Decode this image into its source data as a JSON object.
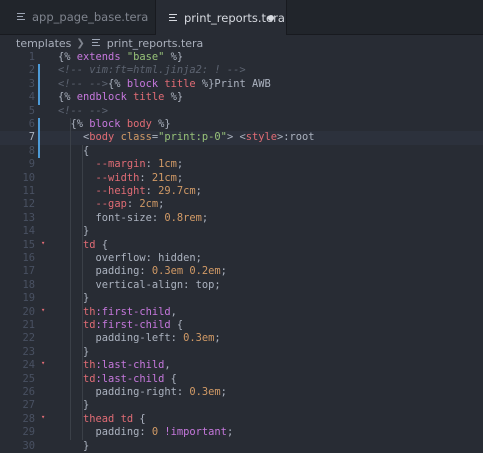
{
  "tabs": [
    {
      "label": "app_page_base.tera",
      "active": false,
      "dirty": false
    },
    {
      "label": "print_reports.tera",
      "active": true,
      "dirty": true
    }
  ],
  "breadcrumb": {
    "folder": "templates",
    "file": "print_reports.tera"
  },
  "editor": {
    "current_line": 7,
    "lines": [
      {
        "n": "1",
        "tokens": [
          [
            "p",
            "{% "
          ],
          [
            "k",
            "extends"
          ],
          [
            "p",
            " "
          ],
          [
            "s",
            "\"base\""
          ],
          [
            "p",
            " %}"
          ]
        ]
      },
      {
        "n": "2",
        "tokens": [
          [
            "c",
            "<!-- vim:ft=html.jinja2: ! -->"
          ]
        ]
      },
      {
        "n": "3",
        "tokens": [
          [
            "c",
            "<!-- -->"
          ],
          [
            "p",
            "{% "
          ],
          [
            "k",
            "block"
          ],
          [
            "p",
            " "
          ],
          [
            "t",
            "title"
          ],
          [
            "p",
            " %}Print AWB"
          ]
        ]
      },
      {
        "n": "4",
        "tokens": [
          [
            "p",
            "{% "
          ],
          [
            "k",
            "endblock"
          ],
          [
            "p",
            " "
          ],
          [
            "t",
            "title"
          ],
          [
            "p",
            " %}"
          ]
        ]
      },
      {
        "n": "5",
        "tokens": [
          [
            "c",
            "<!-- -->"
          ]
        ]
      },
      {
        "n": "6",
        "tokens": [
          [
            "p",
            "  {% "
          ],
          [
            "k",
            "block"
          ],
          [
            "p",
            " "
          ],
          [
            "t",
            "body"
          ],
          [
            "p",
            " %}"
          ]
        ]
      },
      {
        "n": "7",
        "tokens": [
          [
            "p",
            "    <"
          ],
          [
            "t",
            "body"
          ],
          [
            "p",
            " "
          ],
          [
            "a",
            "class"
          ],
          [
            "p",
            "="
          ],
          [
            "s",
            "\"print:p-0\""
          ],
          [
            "p",
            "> <"
          ],
          [
            "t",
            "style"
          ],
          [
            "p",
            ">:root"
          ]
        ]
      },
      {
        "n": "8",
        "tokens": [
          [
            "p",
            "    {"
          ]
        ]
      },
      {
        "n": "9",
        "tokens": [
          [
            "p",
            "      "
          ],
          [
            "v",
            "--margin"
          ],
          [
            "p",
            ": "
          ],
          [
            "n",
            "1cm"
          ],
          [
            "p",
            ";"
          ]
        ]
      },
      {
        "n": "10",
        "tokens": [
          [
            "p",
            "      "
          ],
          [
            "v",
            "--width"
          ],
          [
            "p",
            ": "
          ],
          [
            "n",
            "21cm"
          ],
          [
            "p",
            ";"
          ]
        ]
      },
      {
        "n": "11",
        "tokens": [
          [
            "p",
            "      "
          ],
          [
            "v",
            "--height"
          ],
          [
            "p",
            ": "
          ],
          [
            "n",
            "29.7cm"
          ],
          [
            "p",
            ";"
          ]
        ]
      },
      {
        "n": "12",
        "tokens": [
          [
            "p",
            "      "
          ],
          [
            "v",
            "--gap"
          ],
          [
            "p",
            ": "
          ],
          [
            "n",
            "2cm"
          ],
          [
            "p",
            ";"
          ]
        ]
      },
      {
        "n": "13",
        "tokens": [
          [
            "p",
            "      font-size: "
          ],
          [
            "n",
            "0.8rem"
          ],
          [
            "p",
            ";"
          ]
        ]
      },
      {
        "n": "14",
        "tokens": [
          [
            "p",
            "    }"
          ]
        ]
      },
      {
        "n": "15",
        "tokens": [
          [
            "p",
            "    "
          ],
          [
            "t",
            "td"
          ],
          [
            "p",
            " {"
          ]
        ]
      },
      {
        "n": "16",
        "tokens": [
          [
            "p",
            "      overflow: hidden;"
          ]
        ]
      },
      {
        "n": "17",
        "tokens": [
          [
            "p",
            "      padding: "
          ],
          [
            "n",
            "0.3em 0.2em"
          ],
          [
            "p",
            ";"
          ]
        ]
      },
      {
        "n": "18",
        "tokens": [
          [
            "p",
            "      vertical-align: top;"
          ]
        ]
      },
      {
        "n": "19",
        "tokens": [
          [
            "p",
            "    }"
          ]
        ]
      },
      {
        "n": "20",
        "tokens": [
          [
            "p",
            "    "
          ],
          [
            "t",
            "th"
          ],
          [
            "k",
            ":first-child"
          ],
          [
            "p",
            ","
          ]
        ]
      },
      {
        "n": "21",
        "tokens": [
          [
            "p",
            "    "
          ],
          [
            "t",
            "td"
          ],
          [
            "k",
            ":first-child"
          ],
          [
            "p",
            " {"
          ]
        ]
      },
      {
        "n": "22",
        "tokens": [
          [
            "p",
            "      padding-left: "
          ],
          [
            "n",
            "0.3em"
          ],
          [
            "p",
            ";"
          ]
        ]
      },
      {
        "n": "23",
        "tokens": [
          [
            "p",
            "    }"
          ]
        ]
      },
      {
        "n": "24",
        "tokens": [
          [
            "p",
            "    "
          ],
          [
            "t",
            "th"
          ],
          [
            "k",
            ":last-child"
          ],
          [
            "p",
            ","
          ]
        ]
      },
      {
        "n": "25",
        "tokens": [
          [
            "p",
            "    "
          ],
          [
            "t",
            "td"
          ],
          [
            "k",
            ":last-child"
          ],
          [
            "p",
            " {"
          ]
        ]
      },
      {
        "n": "26",
        "tokens": [
          [
            "p",
            "      padding-right: "
          ],
          [
            "n",
            "0.3em"
          ],
          [
            "p",
            ";"
          ]
        ]
      },
      {
        "n": "27",
        "tokens": [
          [
            "p",
            "    }"
          ]
        ]
      },
      {
        "n": "28",
        "tokens": [
          [
            "p",
            "    "
          ],
          [
            "t",
            "thead td"
          ],
          [
            "p",
            " {"
          ]
        ]
      },
      {
        "n": "29",
        "tokens": [
          [
            "p",
            "      padding: "
          ],
          [
            "n",
            "0"
          ],
          [
            "p",
            " "
          ],
          [
            "k",
            "!important"
          ],
          [
            "p",
            ";"
          ]
        ]
      },
      {
        "n": "30",
        "tokens": [
          [
            "p",
            "    }"
          ]
        ]
      }
    ]
  },
  "gutter_marks": [
    {
      "line": 2,
      "color": "#4d9ad6"
    },
    {
      "line": 3,
      "color": "#4d9ad6"
    },
    {
      "line": 4,
      "color": "#4d9ad6"
    },
    {
      "line": 6,
      "color": "#4d9ad6"
    },
    {
      "line": 7,
      "color": "#4d9ad6"
    },
    {
      "line": 8,
      "color": "#4d9ad6"
    }
  ],
  "fold_markers": [
    15,
    20,
    24,
    28
  ]
}
